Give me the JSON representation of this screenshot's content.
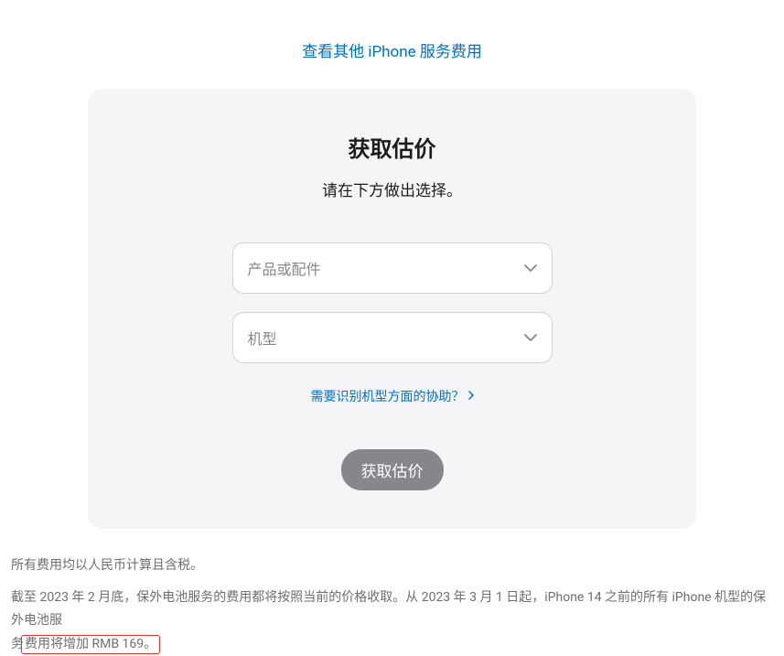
{
  "topLink": "查看其他 iPhone 服务费用",
  "card": {
    "title": "获取估价",
    "subtitle": "请在下方做出选择。",
    "select1_placeholder": "产品或配件",
    "select2_placeholder": "机型",
    "helpLink": "需要识别机型方面的协助？",
    "submitLabel": "获取估价"
  },
  "footer": {
    "line1": "所有费用均以人民币计算且含税。",
    "line2_part1": "截至 2023 年 2 月底，保外电池服务的费用都将按照当前的价格收取。从 2023 年 3 月 1 日起，iPhone 14 之前的所有 iPhone 机型的保外电池服",
    "line2_part2": "务",
    "line2_highlight": "费用将增加 RMB 169。"
  }
}
